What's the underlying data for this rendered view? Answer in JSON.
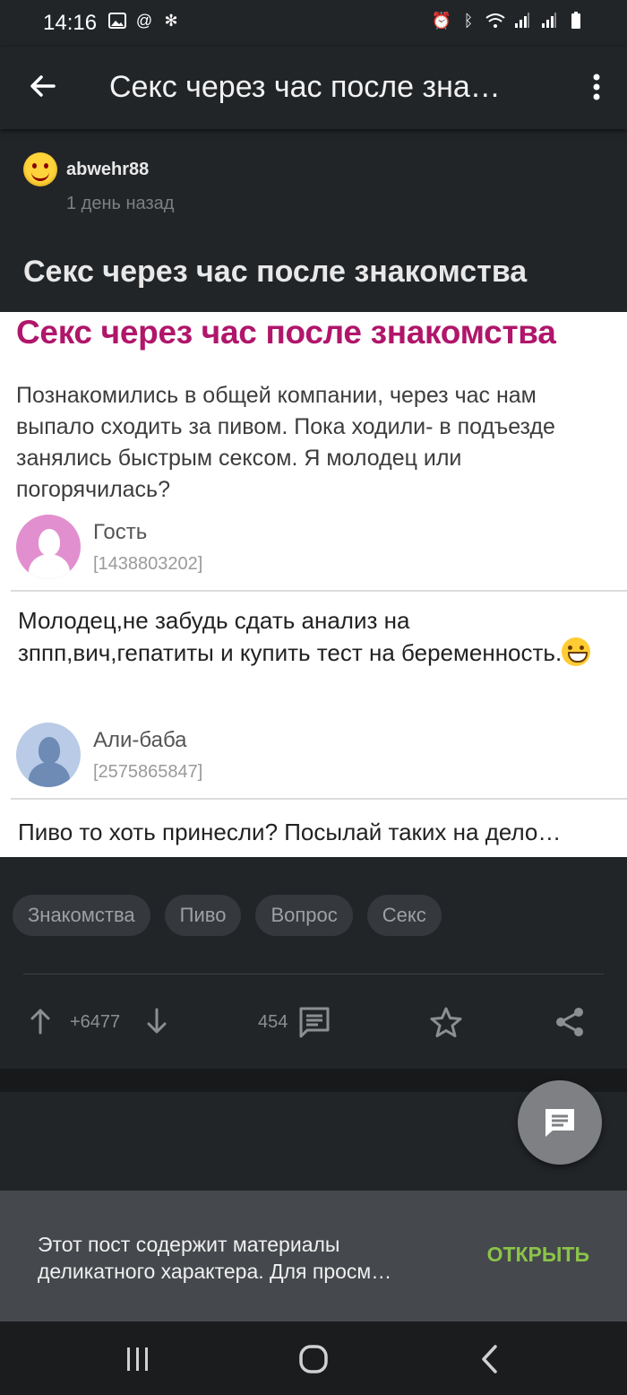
{
  "status_bar": {
    "time": "14:16",
    "left_icons": [
      "image-icon",
      "at-icon",
      "fan-icon"
    ],
    "right_icons": [
      "alarm-icon",
      "bluetooth-icon",
      "wifi-icon",
      "signal-icon",
      "signal-icon",
      "battery-icon"
    ]
  },
  "app_bar": {
    "title": "Секс  через час после зна…"
  },
  "post": {
    "author": "abwehr88",
    "time": "1 день назад",
    "title": "Секс  через час после знакомства"
  },
  "embed": {
    "title": "Секс через час после знакомства",
    "question": "Познакомились в общей компании, через час нам выпало сходить за пивом. Пока ходили- в подъезде занялись быстрым сексом. Я молодец или погорячилась?",
    "users": [
      {
        "name": "Гость",
        "id": "[1438803202]",
        "avatar_color": "#e28fcf"
      },
      {
        "name": "Али-баба",
        "id": "[2575865847]",
        "avatar_color": "#b9cbe6"
      }
    ],
    "comments": [
      "Молодец,не забудь сдать анализ на зппп,вич,гепатиты и купить тест на беременность.",
      "Пиво то хоть принесли? Посылай таких на дело…"
    ]
  },
  "tags": [
    "Знакомства",
    "Пиво",
    "Вопрос",
    "Секс"
  ],
  "actions": {
    "rating": "+6477",
    "comments": "454"
  },
  "snackbar": {
    "line1": "Этот пост содержит материалы",
    "line2": "деликатного характера. Для просм…",
    "action": "ОТКРЫТЬ"
  },
  "colors": {
    "background": "#222528",
    "accent": "#8bc34a",
    "embed_title": "#b0166a"
  }
}
